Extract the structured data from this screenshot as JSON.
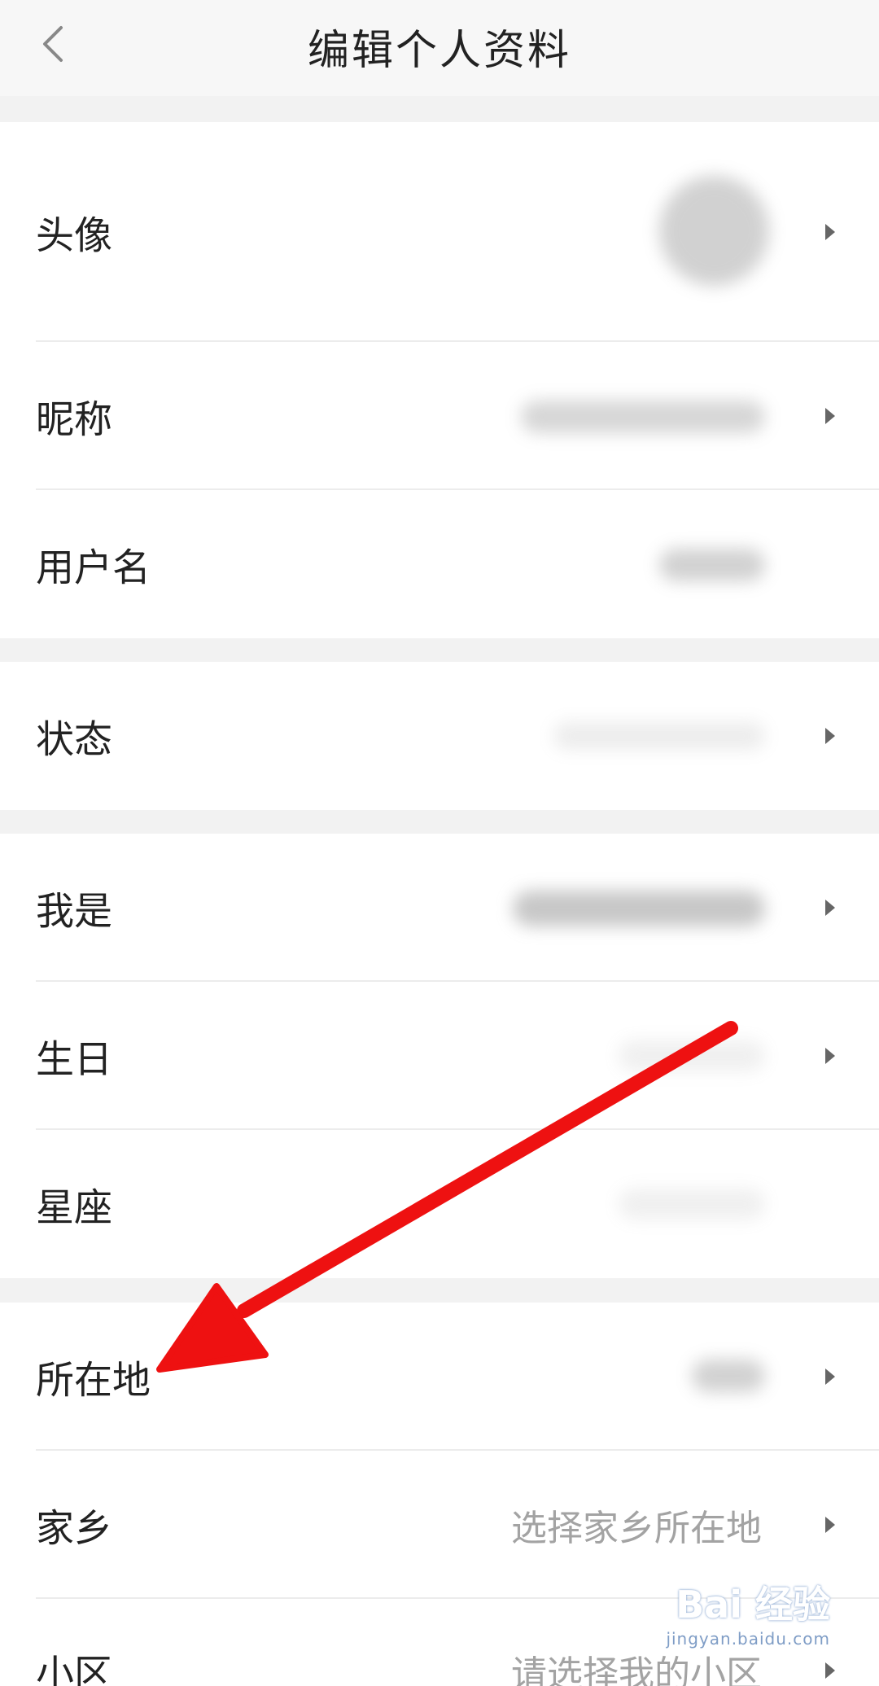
{
  "header": {
    "title": "编辑个人资料",
    "back_icon": "chevron-left-icon"
  },
  "rows": [
    {
      "label": "头像",
      "value": "",
      "has_chevron": true
    },
    {
      "label": "昵称",
      "value": "",
      "has_chevron": true
    },
    {
      "label": "用户名",
      "value": "",
      "has_chevron": false
    },
    {
      "label": "状态",
      "value": "",
      "has_chevron": true
    },
    {
      "label": "我是",
      "value": "",
      "has_chevron": true
    },
    {
      "label": "生日",
      "value": "",
      "has_chevron": true
    },
    {
      "label": "星座",
      "value": "",
      "has_chevron": false
    },
    {
      "label": "所在地",
      "value": "",
      "has_chevron": true
    },
    {
      "label": "家乡",
      "value": "选择家乡所在地",
      "has_chevron": true
    },
    {
      "label": "小区",
      "value": "请选择我的小区",
      "has_chevron": true
    }
  ],
  "annotation": {
    "arrow_color": "#ee1111",
    "points_to": "所在地"
  },
  "watermark": {
    "main": "Bai 经验",
    "sub": "jingyan.baidu.com"
  },
  "colors": {
    "background": "#f2f2f2",
    "row_background": "#ffffff",
    "label_text": "#222222",
    "value_text": "#a3a3a3",
    "arrow": "#ee1111"
  }
}
